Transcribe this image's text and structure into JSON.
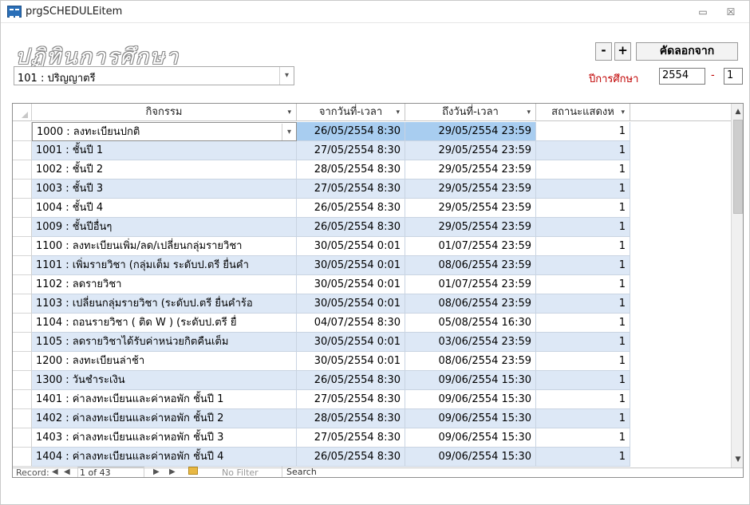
{
  "window": {
    "title": "prgSCHEDULEitem",
    "minimize_glyph": "▭",
    "close_glyph": "☒"
  },
  "header": {
    "page_title": "ปฏิทินการศึกษา",
    "level_value": "101 : ปริญญาตรี",
    "minus_label": "-",
    "plus_label": "+",
    "copy_label": "คัดลอกจาก",
    "year_label": "ปีการศึกษา",
    "year_value": "2554",
    "year_separator": "-",
    "term_value": "1"
  },
  "grid": {
    "columns": [
      "กิจกรรม",
      "จากวันที่-เวลา",
      "ถึงวันที่-เวลา",
      "สถานะแสดงห"
    ],
    "rows": [
      {
        "activity": "1000 : ลงทะเบียนปกติ",
        "from": "26/05/2554 8:30",
        "to": "29/05/2554 23:59",
        "status": "1"
      },
      {
        "activity": "1001 : ชั้นปี 1",
        "from": "27/05/2554 8:30",
        "to": "29/05/2554 23:59",
        "status": "1"
      },
      {
        "activity": "1002 : ชั้นปี 2",
        "from": "28/05/2554 8:30",
        "to": "29/05/2554 23:59",
        "status": "1"
      },
      {
        "activity": "1003 : ชั้นปี 3",
        "from": "27/05/2554 8:30",
        "to": "29/05/2554 23:59",
        "status": "1"
      },
      {
        "activity": "1004 : ชั้นปี 4",
        "from": "26/05/2554 8:30",
        "to": "29/05/2554 23:59",
        "status": "1"
      },
      {
        "activity": "1009 : ชั้นปีอื่นๆ",
        "from": "26/05/2554 8:30",
        "to": "29/05/2554 23:59",
        "status": "1"
      },
      {
        "activity": "1100 : ลงทะเบียนเพิ่ม/ลด/เปลี่ยนกลุ่มรายวิชา",
        "from": "30/05/2554 0:01",
        "to": "01/07/2554 23:59",
        "status": "1"
      },
      {
        "activity": "1101 : เพิ่มรายวิชา (กลุ่มเต็ม ระดับป.ตรี ยื่นคำ",
        "from": "30/05/2554 0:01",
        "to": "08/06/2554 23:59",
        "status": "1"
      },
      {
        "activity": "1102 : ลดรายวิชา",
        "from": "30/05/2554 0:01",
        "to": "01/07/2554 23:59",
        "status": "1"
      },
      {
        "activity": "1103 : เปลี่ยนกลุ่มรายวิชา (ระดับป.ตรี ยื่นคำร้อ",
        "from": "30/05/2554 0:01",
        "to": "08/06/2554 23:59",
        "status": "1"
      },
      {
        "activity": "1104 : ถอนรายวิชา ( ติด W ) (ระดับป.ตรี ยื่",
        "from": "04/07/2554 8:30",
        "to": "05/08/2554 16:30",
        "status": "1"
      },
      {
        "activity": "1105 : ลดรายวิชาได้รับค่าหน่วยกิตคืนเต็ม",
        "from": "30/05/2554 0:01",
        "to": "03/06/2554 23:59",
        "status": "1"
      },
      {
        "activity": "1200 : ลงทะเบียนล่าช้า",
        "from": "30/05/2554 0:01",
        "to": "08/06/2554 23:59",
        "status": "1"
      },
      {
        "activity": "1300 : วันชำระเงิน",
        "from": "26/05/2554 8:30",
        "to": "09/06/2554 15:30",
        "status": "1"
      },
      {
        "activity": "1401 : ค่าลงทะเบียนและค่าหอพัก ชั้นปี 1",
        "from": "27/05/2554 8:30",
        "to": "09/06/2554 15:30",
        "status": "1"
      },
      {
        "activity": "1402 : ค่าลงทะเบียนและค่าหอพัก ชั้นปี 2",
        "from": "28/05/2554 8:30",
        "to": "09/06/2554 15:30",
        "status": "1"
      },
      {
        "activity": "1403 : ค่าลงทะเบียนและค่าหอพัก ชั้นปี 3",
        "from": "27/05/2554 8:30",
        "to": "09/06/2554 15:30",
        "status": "1"
      },
      {
        "activity": "1404 : ค่าลงทะเบียนและค่าหอพัก ชั้นปี 4",
        "from": "26/05/2554 8:30",
        "to": "09/06/2554 15:30",
        "status": "1"
      }
    ]
  },
  "navigation": {
    "record_label": "Record:",
    "first_glyph": "◀",
    "prev_glyph": "◀",
    "count_text": "1 of 43",
    "next_glyph": "▶",
    "last_glyph": "▶",
    "no_filter_label": "No Filter",
    "search_label": "Search"
  },
  "colors": {
    "row_alt": "#dde8f6",
    "row_selected": "#a8cdf0",
    "year_label": "#c00000"
  }
}
